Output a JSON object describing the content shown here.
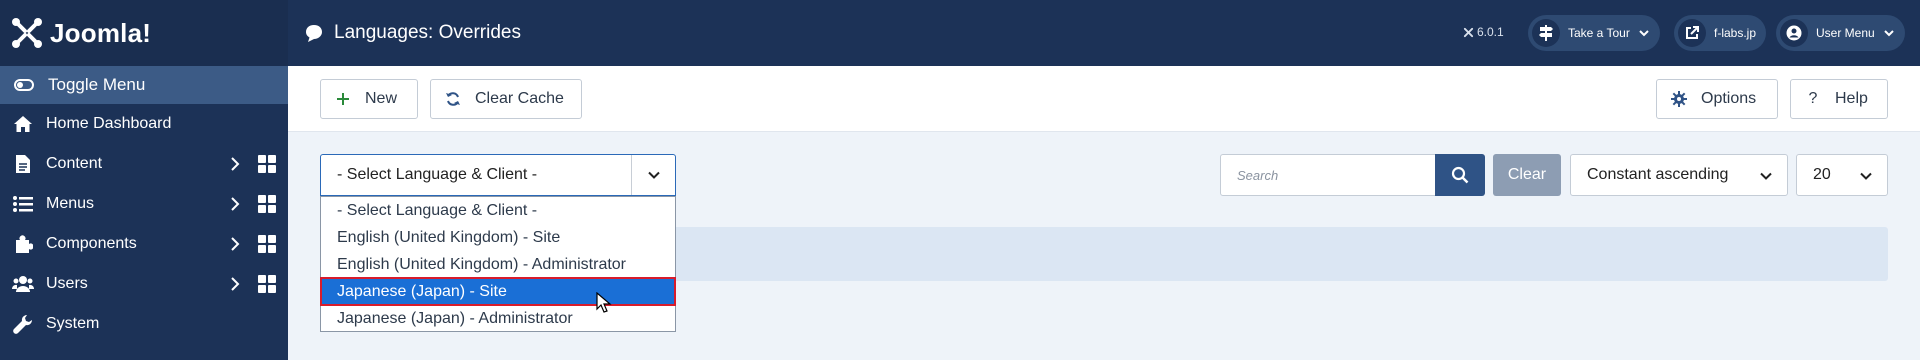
{
  "brand": {
    "name": "Joomla!"
  },
  "sidebar": {
    "toggle_label": "Toggle Menu",
    "items": [
      {
        "label": "Home Dashboard",
        "icon": "home-icon"
      },
      {
        "label": "Content",
        "icon": "file-icon"
      },
      {
        "label": "Menus",
        "icon": "list-icon"
      },
      {
        "label": "Components",
        "icon": "puzzle-icon"
      },
      {
        "label": "Users",
        "icon": "users-icon"
      },
      {
        "label": "System",
        "icon": "wrench-icon"
      }
    ]
  },
  "header": {
    "title": "Languages: Overrides",
    "version": "6.0.1",
    "take_tour": "Take a Tour",
    "site_link": "f-labs.jp",
    "user_menu": "User Menu"
  },
  "toolbar": {
    "new_label": "New",
    "clear_cache_label": "Clear Cache",
    "options_label": "Options",
    "help_label": "Help"
  },
  "filters": {
    "language_client_selected": "- Select Language & Client -",
    "search_placeholder": "Search",
    "clear_label": "Clear",
    "sort_selected": "Constant ascending",
    "limit_selected": "20"
  },
  "dropdown": {
    "options": [
      "- Select Language & Client -",
      "English (United Kingdom) - Site",
      "English (United Kingdom) - Administrator",
      "Japanese (Japan) - Site",
      "Japanese (Japan) - Administrator"
    ],
    "highlighted": "Japanese (Japan) - Site"
  },
  "colors": {
    "sidebar_bg": "#1c3257",
    "toggle_bg": "#3c5b86",
    "accent": "#2f5386",
    "highlight": "#1a6fd6",
    "highlight_outline": "#d81c2c"
  }
}
